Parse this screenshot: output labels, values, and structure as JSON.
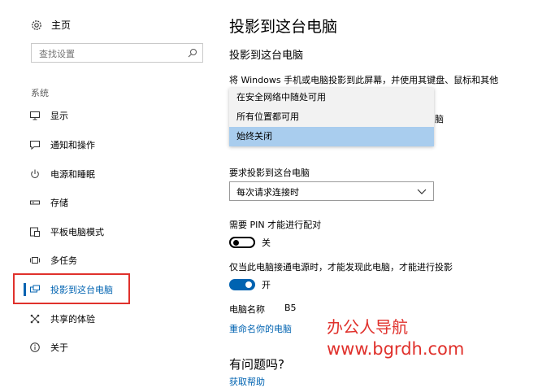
{
  "sidebar": {
    "home_label": "主页",
    "search_placeholder": "查找设置",
    "section_label": "系统",
    "items": [
      {
        "label": "显示",
        "icon": "monitor-icon"
      },
      {
        "label": "通知和操作",
        "icon": "message-icon"
      },
      {
        "label": "电源和睡眠",
        "icon": "power-icon"
      },
      {
        "label": "存储",
        "icon": "storage-icon"
      },
      {
        "label": "平板电脑模式",
        "icon": "tablet-mode-icon"
      },
      {
        "label": "多任务",
        "icon": "multitask-icon"
      },
      {
        "label": "投影到这台电脑",
        "icon": "project-icon"
      },
      {
        "label": "共享的体验",
        "icon": "share-icon"
      },
      {
        "label": "关于",
        "icon": "info-icon"
      }
    ],
    "active_index": 6,
    "accent": "#0063b1"
  },
  "main": {
    "page_title": "投影到这台电脑",
    "subtitle": "投影到这台电脑",
    "description": "将 Windows 手机或电脑投影到此屏幕，并使用其键盘、鼠标和其他",
    "description_tail": "脑",
    "dropdown_options": [
      "在安全网络中随处可用",
      "所有位置都可用",
      "始终关闭"
    ],
    "dropdown_selected": "始终关闭",
    "request_label": "要求投影到这台电脑",
    "request_value": "每次请求连接时",
    "pin_label": "需要 PIN 才能进行配对",
    "pin_toggle_state": "关",
    "power_label": "仅当此电脑接通电源时，才能发现此电脑，才能进行投影",
    "power_toggle_state": "开",
    "pc_name_label": "电脑名称",
    "pc_name_value": "B5",
    "rename_link": "重命名你的电脑",
    "question_title": "有问题吗?",
    "help_link": "获取帮助"
  },
  "watermark": {
    "line1": "办公人导航",
    "line2": "www.bgrdh.com",
    "color": "#e0312c"
  }
}
